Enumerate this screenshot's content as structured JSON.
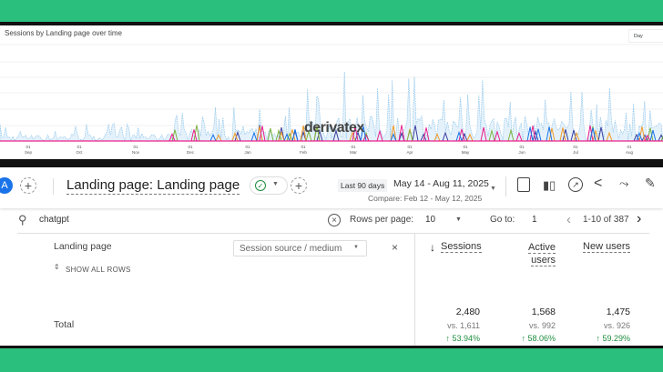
{
  "chart": {
    "title": "Sessions by Landing page over time",
    "granularity": "Day",
    "watermark": "derivatex",
    "x_ticks": [
      {
        "day": "01",
        "month": "Sep"
      },
      {
        "day": "01",
        "month": "Oct"
      },
      {
        "day": "01",
        "month": "Nov"
      },
      {
        "day": "01",
        "month": "Dec"
      },
      {
        "day": "01",
        "month": "Jan"
      },
      {
        "day": "01",
        "month": "Feb"
      },
      {
        "day": "01",
        "month": "Mar"
      },
      {
        "day": "01",
        "month": "Apr"
      },
      {
        "day": "01",
        "month": "May"
      },
      {
        "day": "01",
        "month": "Jun"
      },
      {
        "day": "01",
        "month": "Jul"
      },
      {
        "day": "01",
        "month": "Aug"
      }
    ],
    "colors": {
      "total": "#8ec5ea",
      "series": [
        "#3b3f9e",
        "#f29a26",
        "#7cb342",
        "#e91e8c",
        "#1a73e8"
      ]
    }
  },
  "toolbar": {
    "avatar": "A",
    "title": "Landing page: Landing page",
    "date_chip": "Last 90 days",
    "date_range": "May 14 - Aug 11, 2025",
    "compare": "Compare: Feb 12 - May 12, 2025"
  },
  "search": {
    "value": "chatgpt",
    "rows_per_page_label": "Rows per page:",
    "rows_per_page": "10",
    "goto_label": "Go to:",
    "goto_value": "1",
    "pagination": "1-10 of 387"
  },
  "table": {
    "dimension_header": "Landing page",
    "secondary_dimension": "Session source / medium",
    "show_all_rows": "SHOW ALL ROWS",
    "total_label": "Total",
    "columns": [
      {
        "label": "Sessions",
        "label2": "",
        "sorted": true,
        "total": "2,480",
        "compare": "vs. 1,611",
        "change": "53.94%"
      },
      {
        "label": "Active",
        "label2": "users",
        "sorted": false,
        "total": "1,568",
        "compare": "vs. 992",
        "change": "58.06%"
      },
      {
        "label": "New users",
        "label2": "",
        "sorted": false,
        "total": "1,475",
        "compare": "vs. 926",
        "change": "59.29%"
      }
    ]
  }
}
